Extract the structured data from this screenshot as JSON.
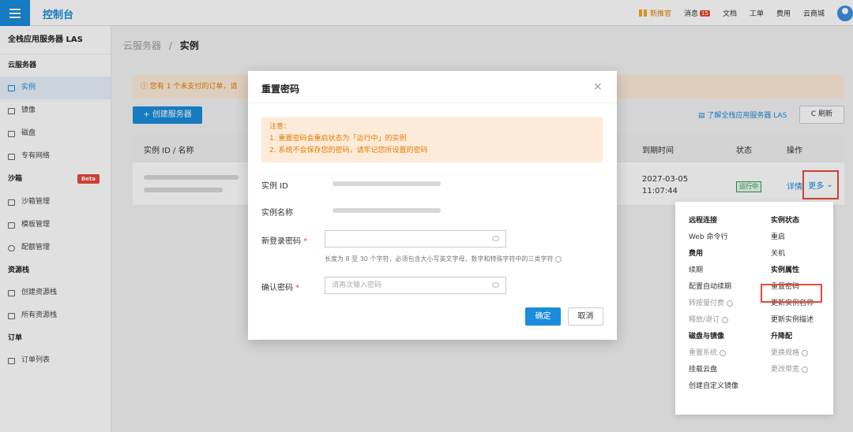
{
  "topbar": {
    "console": "控制台",
    "nav": [
      "新推官",
      "消息",
      "文档",
      "工单",
      "费用",
      "云商城"
    ],
    "msg_badge": "15"
  },
  "sidebar": {
    "title": "全栈应用服务器 LAS",
    "groups": [
      {
        "label": "云服务器",
        "items": [
          "实例",
          "镜像",
          "磁盘",
          "专有网络"
        ]
      },
      {
        "label": "沙箱",
        "badge": "Beta",
        "items": [
          "沙箱管理",
          "模板管理",
          "配额管理"
        ]
      },
      {
        "label": "资源栈",
        "items": [
          "创建资源栈",
          "所有资源栈"
        ]
      },
      {
        "label": "订单",
        "items": [
          "订单列表"
        ]
      }
    ]
  },
  "main": {
    "crumb_parent": "云服务器",
    "crumb_sep": "/",
    "crumb_current": "实例",
    "notice": "您有 1 个未支付的订单，请",
    "create_btn": "+ 创建服务器",
    "learn_link": "了解全栈应用服务器 LAS",
    "refresh_btn": "C 刷新",
    "table": {
      "headers": {
        "id_name": "实例 ID / 名称",
        "expire": "到期时间",
        "status": "状态",
        "ops": "操作"
      },
      "row": {
        "expire_date": "2027-03-05",
        "expire_time": "11:07:44",
        "status": "运行中",
        "detail": "详情",
        "more": "更多"
      }
    }
  },
  "dropdown": {
    "left": [
      {
        "group": "远程连接",
        "options": [
          {
            "label": "Web 命令行",
            "disabled": false
          }
        ]
      },
      {
        "group": "费用",
        "options": [
          {
            "label": "续期",
            "disabled": false
          },
          {
            "label": "配置自动续期",
            "disabled": false
          },
          {
            "label": "转按量付费",
            "disabled": true
          },
          {
            "label": "释放/退订",
            "disabled": true
          }
        ]
      },
      {
        "group": "磁盘与镜像",
        "options": [
          {
            "label": "重置系统",
            "disabled": true
          },
          {
            "label": "挂载云盘",
            "disabled": false
          },
          {
            "label": "创建自定义镜像",
            "disabled": false
          }
        ]
      }
    ],
    "right": [
      {
        "group": "实例状态",
        "options": [
          {
            "label": "重启",
            "disabled": false
          },
          {
            "label": "关机",
            "disabled": false
          }
        ]
      },
      {
        "group": "实例属性",
        "options": [
          {
            "label": "重置密码",
            "disabled": false
          },
          {
            "label": "更新实例名称",
            "disabled": false
          },
          {
            "label": "更新实例描述",
            "disabled": false
          }
        ]
      },
      {
        "group": "升降配",
        "options": [
          {
            "label": "更换规格",
            "disabled": true
          },
          {
            "label": "更改带宽",
            "disabled": true
          }
        ]
      }
    ]
  },
  "modal": {
    "title": "重置密码",
    "close": "×",
    "note_title": "注意：",
    "note_1": "1. 重置密码会重启状态为「运行中」的实例",
    "note_2": "2. 系统不会保存您的密码，请牢记您所设置的密码",
    "instance_id_label": "实例 ID",
    "instance_name_label": "实例名称",
    "new_password_label": "新登录密码",
    "required_mark": "*",
    "password_hint": "长度为 8 至 30 个字符，必须包含大小写英文字母、数字和特殊字符中的三类字符",
    "confirm_label": "确认密码",
    "confirm_placeholder": "请再次输入密码",
    "ok": "确定",
    "cancel": "取消"
  }
}
